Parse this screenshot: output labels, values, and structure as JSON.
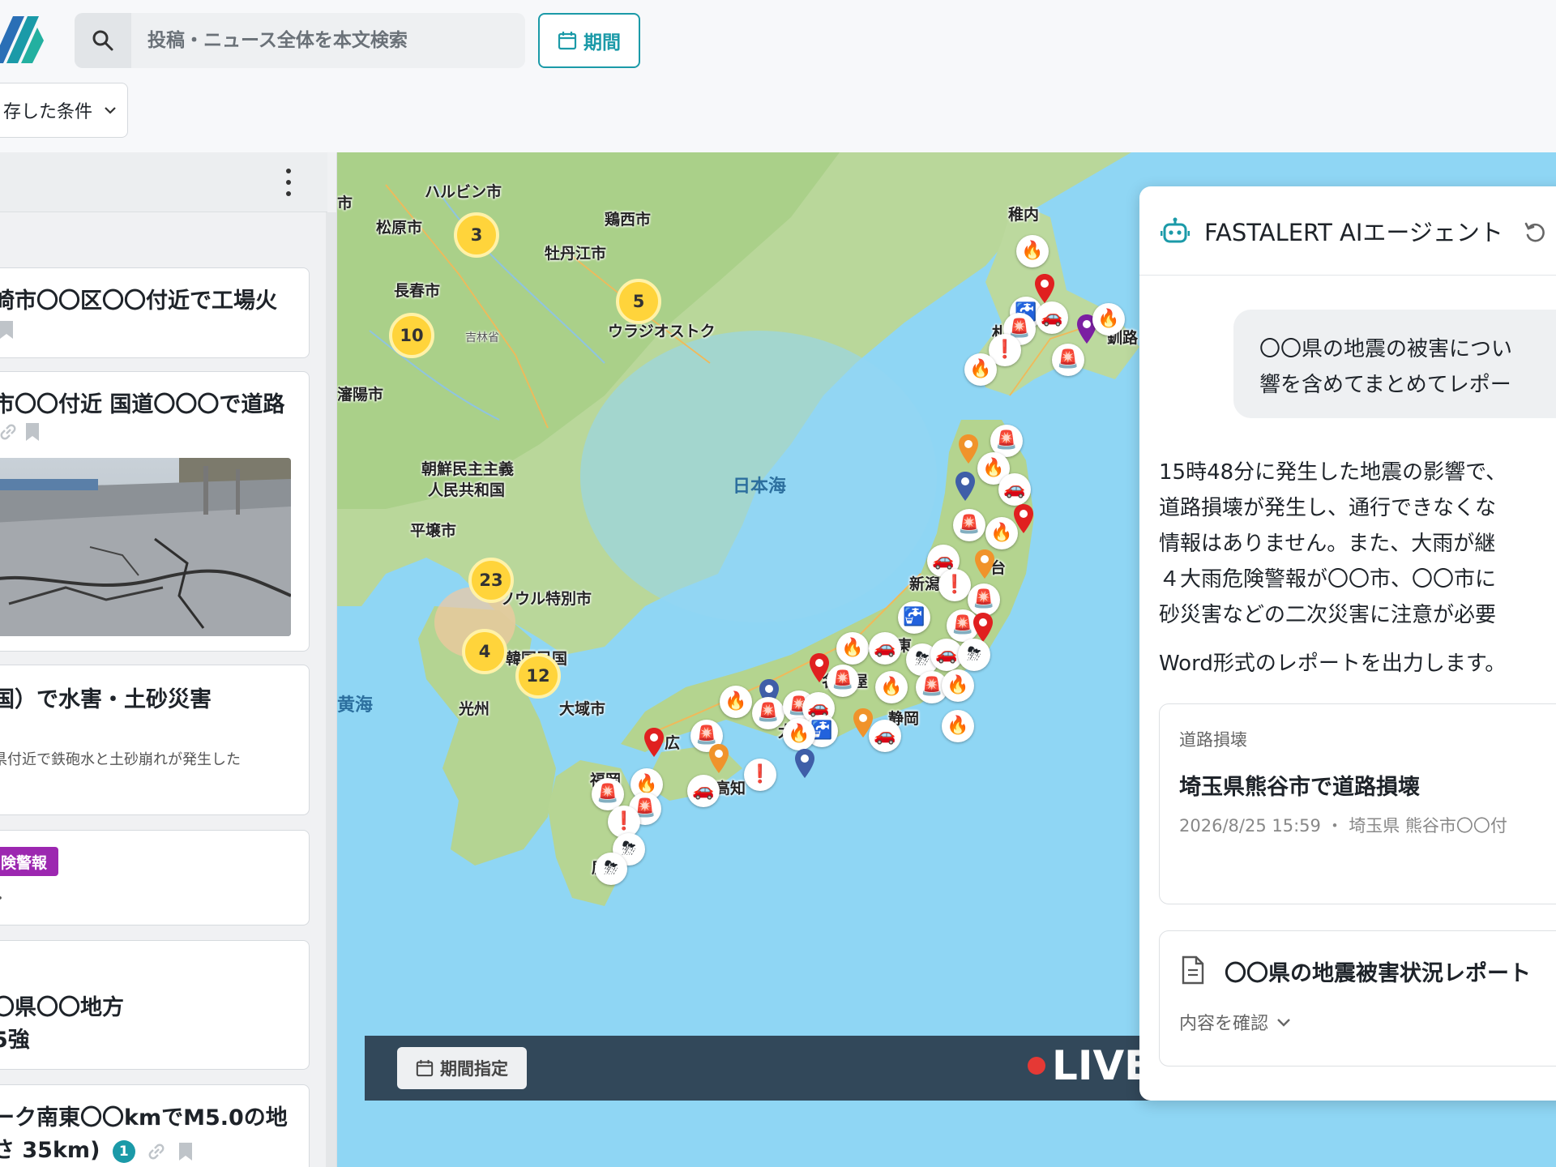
{
  "header": {
    "search_placeholder": "投稿・ニュース全体を本文検索",
    "period_label": "期間",
    "saved_conditions_label": "存した条件"
  },
  "feed": {
    "items": [
      {
        "title": "崎市〇〇区〇〇付近で工場火"
      },
      {
        "title": "市〇〇付近 国道〇〇〇で道路"
      },
      {
        "title": "国）で水害・土砂災害",
        "subtitle": "県付近で鉄砲水と土砂崩れが発生した"
      },
      {
        "tag": "険警報",
        "subtitle": "・"
      },
      {
        "title_line1": "〇県〇〇地方",
        "title_line2": "5強"
      },
      {
        "title_line1": "ーク南東〇〇kmでM5.0の地",
        "title_line2": "さ 35km)",
        "badge": "1"
      }
    ]
  },
  "map": {
    "labels": {
      "harbin": "ハルビン市",
      "songyuan": "松原市",
      "jixi": "鶏西市",
      "mudanjiang": "牡丹江市",
      "changchun": "長春市",
      "jilin_prov": "吉林省",
      "vladivostok": "ウラジオストク",
      "shenyang": "瀋陽市",
      "dprk_1": "朝鮮民主主義",
      "dprk_2": "人民共和国",
      "pyongyang": "平壌市",
      "seoul": "ソウル特別市",
      "rok": "韓国民国",
      "gwangju": "光州",
      "daegu": "大域市",
      "sea_of_japan": "日本海",
      "yellow_sea": "黄海",
      "wakkanai": "稚内",
      "sapporo": "札",
      "kushiro": "釧路",
      "sendai": "台",
      "niigata": "新潟",
      "tokyo": "東",
      "shizuoka": "静岡",
      "nagoya": "名古屋",
      "osaka": "大",
      "hiroshima": "広",
      "kochi": "高知",
      "fukuoka": "福岡",
      "kagoshima": "鹿",
      "edge": "市"
    },
    "clusters": [
      {
        "id": "c-harbin",
        "count": "3"
      },
      {
        "id": "c-vlad",
        "count": "5"
      },
      {
        "id": "c-changchun",
        "count": "10"
      },
      {
        "id": "c-seoul",
        "count": "23"
      },
      {
        "id": "c-gwangju",
        "count": "4"
      },
      {
        "id": "c-busan",
        "count": "12"
      }
    ],
    "period_spec_label": "期間指定",
    "live_label": "LIVE"
  },
  "ai": {
    "title": "FASTALERT AIエージェント",
    "user_message_line1": "〇〇県の地震の被害につい",
    "user_message_line2": "響を含めてまとめてレポー",
    "answer_lines": [
      "15時48分に発生した地震の影響で、",
      "道路損壊が発生し、通行できなくな",
      "情報はありません。また、大雨が継",
      "４大雨危険警報が〇〇市、〇〇市に",
      "砂災害などの二次災害に注意が必要"
    ],
    "answer_tail": "Word形式のレポートを出力します。",
    "result_card": {
      "category": "道路損壊",
      "title": "埼玉県熊谷市で道路損壊",
      "meta": "2026/8/25 15:59 ・ 埼玉県 熊谷市〇〇付"
    },
    "report_card": {
      "title": "〇〇県の地震被害状況レポート",
      "check_label": "内容を確認"
    }
  },
  "colors": {
    "accent": "#1b9aa8",
    "cluster": "#ffd43b",
    "live_dot": "#e53935",
    "tag": "#9c27b0"
  }
}
